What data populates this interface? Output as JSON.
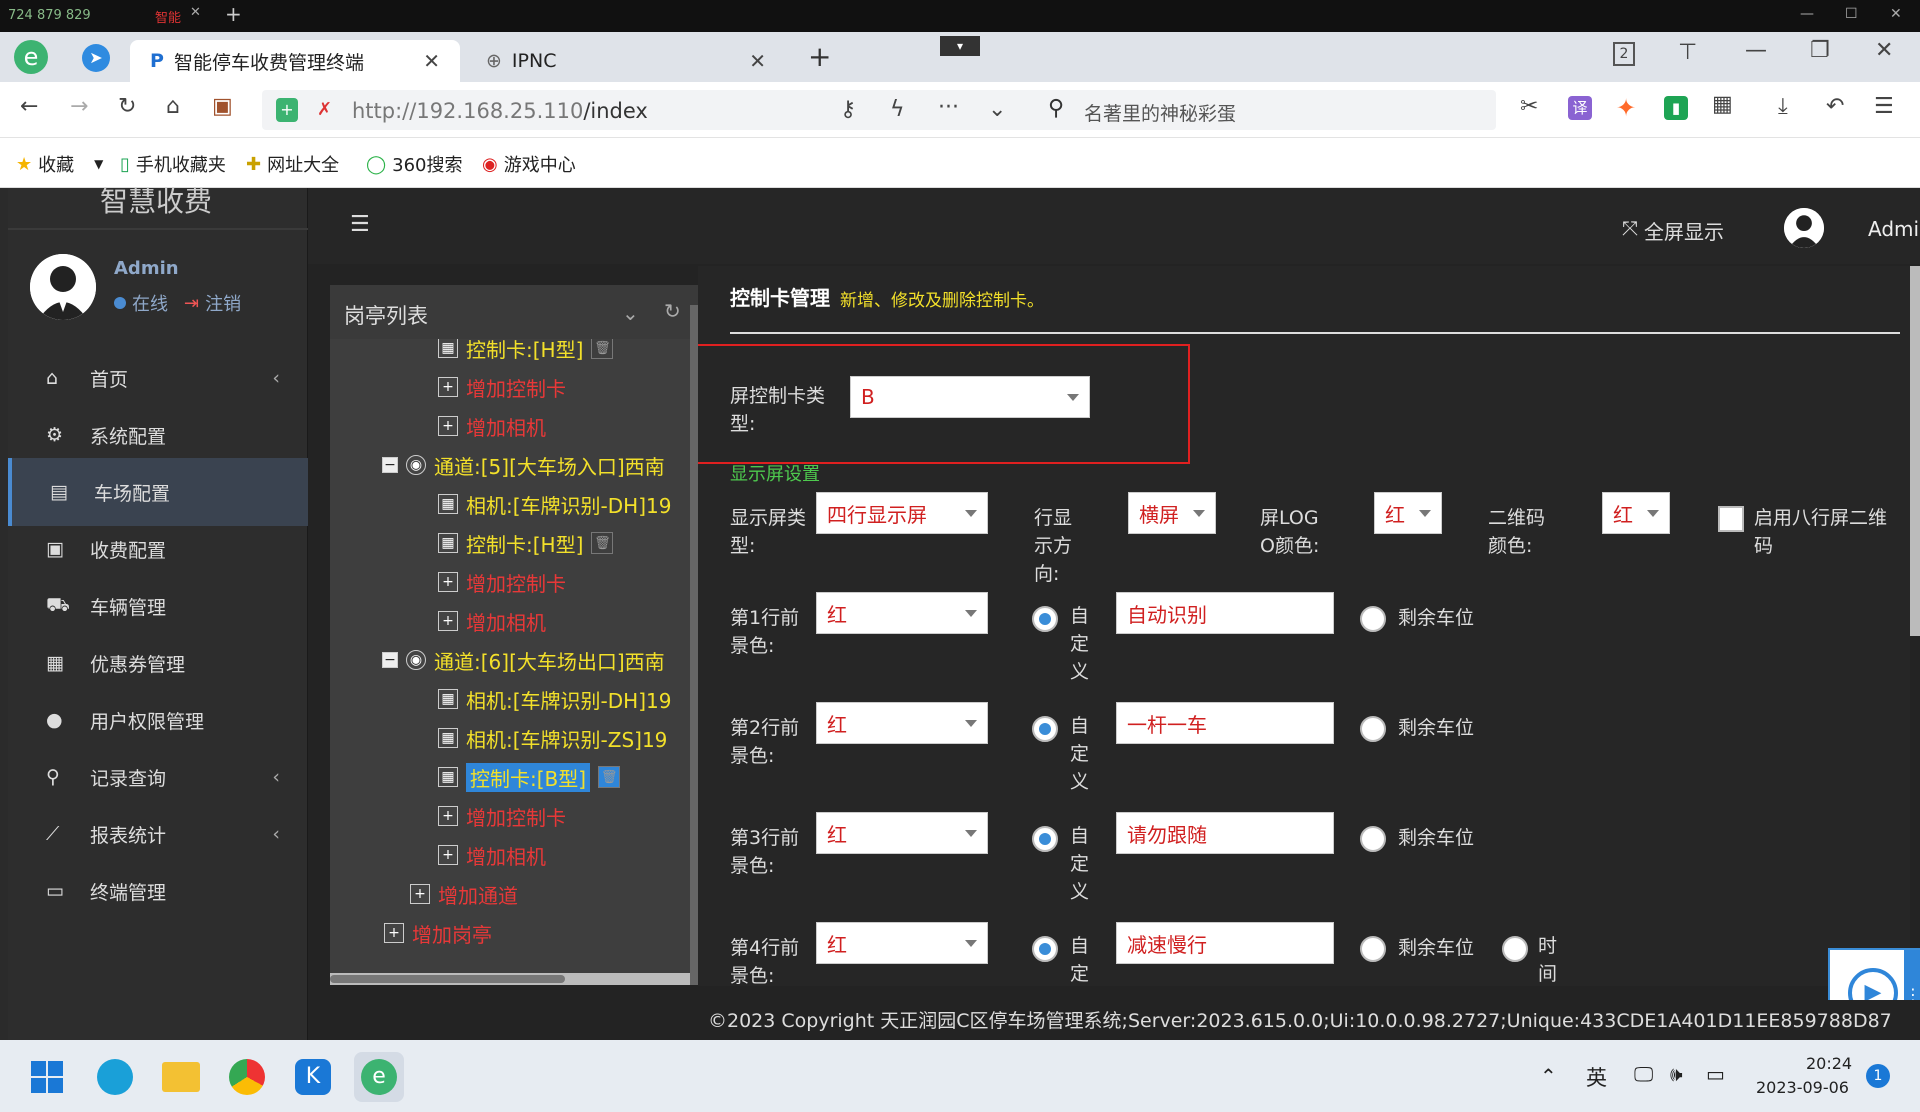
{
  "system": {
    "signal": "724 879 829",
    "mode": "智能"
  },
  "browser": {
    "tabs": [
      {
        "label": "智能停车收费管理终端",
        "icon": "P"
      },
      {
        "label": "IPNC"
      }
    ],
    "tab_count": "2",
    "url_host": "http://192.168.25.110",
    "url_path": "/index",
    "search_placeholder": "名著里的神秘彩蛋",
    "bookmarks": [
      "收藏",
      "手机收藏夹",
      "网址大全",
      "360搜索",
      "游戏中心"
    ]
  },
  "app": {
    "brand": "智慧收费",
    "user": {
      "name": "Admin",
      "status": "在线",
      "logout": "注销"
    },
    "header": {
      "fullscreen": "全屏显示",
      "user": "Admin"
    },
    "menu": [
      {
        "label": "首页",
        "icon": "home-icon",
        "chevron": true
      },
      {
        "label": "系统配置",
        "icon": "cogs-icon"
      },
      {
        "label": "车场配置",
        "icon": "file-icon",
        "active": true
      },
      {
        "label": "收费配置",
        "icon": "money-icon"
      },
      {
        "label": "车辆管理",
        "icon": "car-icon"
      },
      {
        "label": "优惠券管理",
        "icon": "calendar-icon"
      },
      {
        "label": "用户权限管理",
        "icon": "user-icon"
      },
      {
        "label": "记录查询",
        "icon": "search-icon",
        "chevron": true
      },
      {
        "label": "报表统计",
        "icon": "chart-icon",
        "chevron": true
      },
      {
        "label": "终端管理",
        "icon": "monitor-icon"
      }
    ],
    "tree": {
      "title": "岗亭列表",
      "nodes": [
        {
          "label": "控制卡:[H型]",
          "color": "yellow",
          "trash": true
        },
        {
          "label": "增加控制卡",
          "color": "red"
        },
        {
          "label": "增加相机",
          "color": "red"
        },
        {
          "label": "通道:[5][大车场入口]西南",
          "color": "yellow",
          "expand": "−"
        },
        {
          "label": "相机:[车牌识别-DH]19",
          "color": "yellow"
        },
        {
          "label": "控制卡:[H型]",
          "color": "yellow",
          "trash": true
        },
        {
          "label": "增加控制卡",
          "color": "red"
        },
        {
          "label": "增加相机",
          "color": "red"
        },
        {
          "label": "通道:[6][大车场出口]西南",
          "color": "yellow",
          "expand": "−"
        },
        {
          "label": "相机:[车牌识别-DH]19",
          "color": "yellow"
        },
        {
          "label": "相机:[车牌识别-ZS]19",
          "color": "yellow"
        },
        {
          "label": "控制卡:[B型]",
          "color": "yellow",
          "trash": true,
          "selected": true
        },
        {
          "label": "增加控制卡",
          "color": "red"
        },
        {
          "label": "增加相机",
          "color": "red"
        },
        {
          "label": "增加通道",
          "color": "red"
        },
        {
          "label": "增加岗亭",
          "color": "red"
        }
      ]
    },
    "form": {
      "title": "控制卡管理",
      "subtitle": "新增、修改及删除控制卡。",
      "card_type_label": "屏控制卡类型:",
      "card_type_value": "B",
      "display_section": "显示屏设置",
      "screen_type_label": "显示屏类型:",
      "screen_type_value": "四行显示屏",
      "direction_label": "行显示方向:",
      "direction_value": "横屏",
      "logo_color_label": "屏LOGO颜色:",
      "logo_color_value": "红",
      "qr_color_label": "二维码颜色:",
      "qr_color_value": "红",
      "eight_line_qr_label": "启用八行屏二维码",
      "custom_label": "自定义",
      "remaining_label": "剩余车位",
      "time_label": "时间",
      "rows": [
        {
          "label": "第1行前景色:",
          "color": "红",
          "text": "自动识别"
        },
        {
          "label": "第2行前景色:",
          "color": "红",
          "text": "一杆一车"
        },
        {
          "label": "第3行前景色:",
          "color": "红",
          "text": "请勿跟随"
        },
        {
          "label": "第4行前景色:",
          "color": "红",
          "text": "减速慢行"
        }
      ]
    },
    "footer": "©2023 Copyright   天正润园C区停车场管理系统;Server:2023.615.0.0;Ui:10.0.0.98.2727;Unique:433CDE1A401D11EE859788D87"
  },
  "taskbar": {
    "lang": "英",
    "time": "20:24",
    "date": "2023-09-06",
    "notif": "1"
  },
  "colors": {
    "accent": "#4a8bd1",
    "highlight_box": "#e02020",
    "tree_yellow": "#f3e02a",
    "tree_red": "#e83838"
  }
}
